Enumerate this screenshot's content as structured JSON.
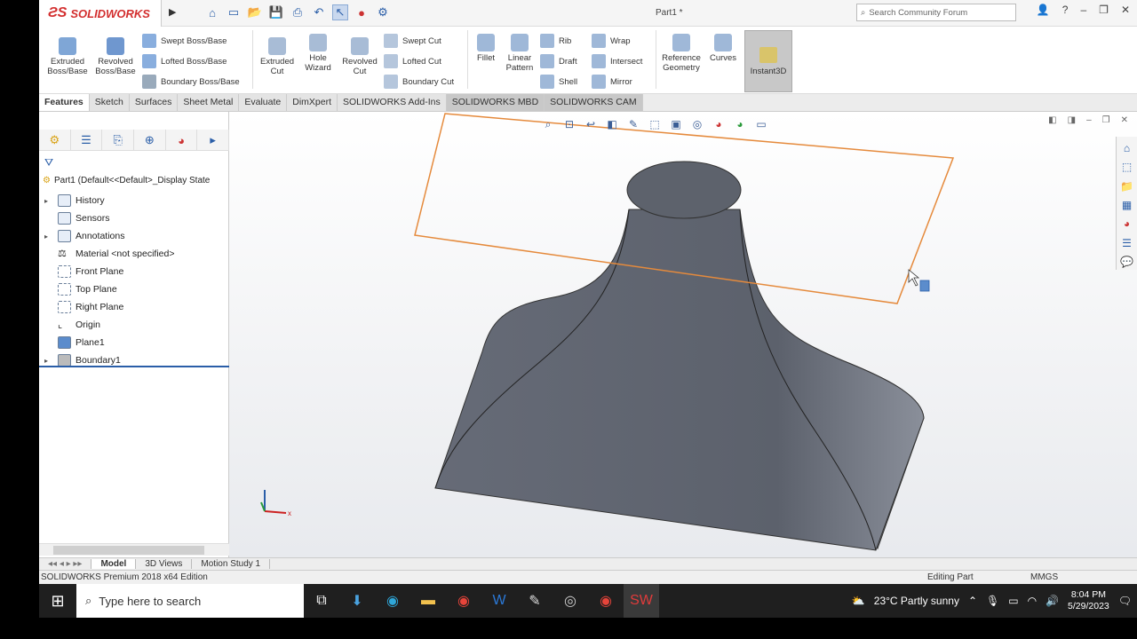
{
  "app": {
    "logo_text": "SOLIDWORKS",
    "document_title": "Part1 *",
    "search_placeholder": "Search Community Forum"
  },
  "ribbon": {
    "large_buttons": [
      {
        "label": "Extruded Boss/Base",
        "icon": "extruded-boss-icon"
      },
      {
        "label": "Revolved Boss/Base",
        "icon": "revolved-boss-icon"
      },
      {
        "label": "Extruded Cut",
        "icon": "extruded-cut-icon"
      },
      {
        "label": "Hole Wizard",
        "icon": "hole-wizard-icon"
      },
      {
        "label": "Revolved Cut",
        "icon": "revolved-cut-icon"
      },
      {
        "label": "Fillet",
        "icon": "fillet-icon"
      },
      {
        "label": "Linear Pattern",
        "icon": "linear-pattern-icon"
      },
      {
        "label": "Reference Geometry",
        "icon": "reference-geometry-icon"
      },
      {
        "label": "Curves",
        "icon": "curves-icon"
      },
      {
        "label": "Instant3D",
        "icon": "instant3d-icon"
      }
    ],
    "small_buttons": {
      "swept_boss": "Swept Boss/Base",
      "lofted_boss": "Lofted Boss/Base",
      "boundary_boss": "Boundary Boss/Base",
      "swept_cut": "Swept Cut",
      "lofted_cut": "Lofted Cut",
      "boundary_cut": "Boundary Cut",
      "rib": "Rib",
      "draft": "Draft",
      "shell": "Shell",
      "wrap": "Wrap",
      "intersect": "Intersect",
      "mirror": "Mirror"
    }
  },
  "tabs": [
    "Features",
    "Sketch",
    "Surfaces",
    "Sheet Metal",
    "Evaluate",
    "DimXpert",
    "SOLIDWORKS Add-Ins",
    "SOLIDWORKS MBD",
    "SOLIDWORKS CAM"
  ],
  "feature_tree": {
    "root": "Part1  (Default<<Default>_Display State",
    "items": [
      {
        "label": "History",
        "expandable": true
      },
      {
        "label": "Sensors",
        "expandable": false
      },
      {
        "label": "Annotations",
        "expandable": true
      },
      {
        "label": "Material <not specified>",
        "expandable": false
      },
      {
        "label": "Front Plane",
        "expandable": false
      },
      {
        "label": "Top Plane",
        "expandable": false
      },
      {
        "label": "Right Plane",
        "expandable": false
      },
      {
        "label": "Origin",
        "expandable": false
      },
      {
        "label": "Plane1",
        "expandable": false
      },
      {
        "label": "Boundary1",
        "expandable": true
      }
    ]
  },
  "bottom_tabs": [
    "Model",
    "3D Views",
    "Motion Study 1"
  ],
  "status_bar": {
    "edition": "SOLIDWORKS Premium 2018 x64 Edition",
    "mode": "Editing Part",
    "units": "MMGS"
  },
  "taskbar": {
    "search_placeholder": "Type here to search",
    "weather": "23°C  Partly sunny",
    "time": "8:04 PM",
    "date": "5/29/2023"
  },
  "colors": {
    "accent": "#2a5ea8",
    "plane_outline": "#e58a3c",
    "model_body": "#5f6470"
  }
}
